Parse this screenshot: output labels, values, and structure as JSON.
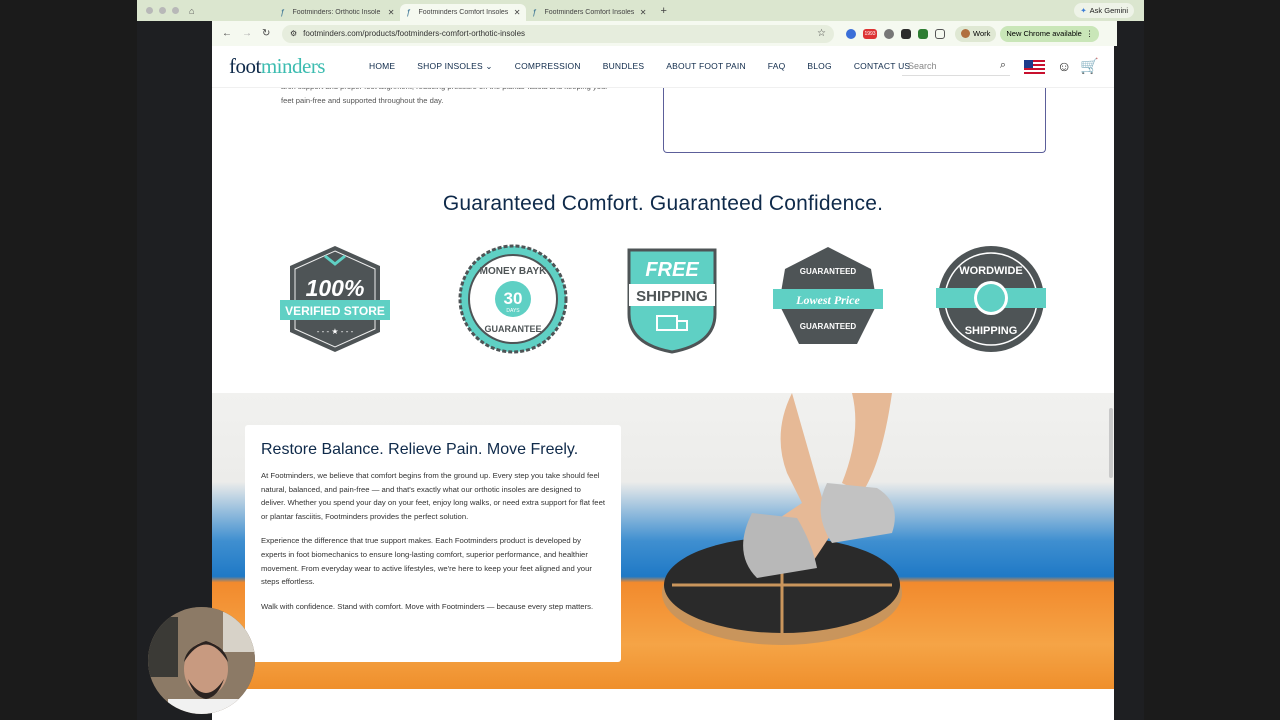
{
  "browser": {
    "tabs": [
      {
        "title": "Footminders: Orthotic Insole"
      },
      {
        "title": "Footminders Comfort Insoles"
      },
      {
        "title": "Footminders Comfort Insoles"
      }
    ],
    "ask_gemini": "Ask Gemini",
    "url": "footminders.com/products/footminders-comfort-orthotic-insoles",
    "profile": "Work",
    "new_chrome": "New Chrome available",
    "ext_badge": "1993"
  },
  "site": {
    "logo_left": "foot",
    "logo_right": "minders",
    "nav": [
      "HOME",
      "SHOP INSOLES",
      "COMPRESSION",
      "BUNDLES",
      "ABOUT FOOT PAIN",
      "FAQ",
      "BLOG",
      "CONTACT US"
    ],
    "search_placeholder": "Search"
  },
  "intro_text": "arch support and proper foot alignment, reducing pressure on the plantar fascia and keeping your feet pain-free and supported throughout the day.",
  "headline": "Guaranteed Comfort. Guaranteed Confidence.",
  "badges": [
    {
      "line1": "100%",
      "line2": "VERIFIED STORE"
    },
    {
      "line1": "MONEY BAYK",
      "line2": "30",
      "line3": "DAYS",
      "line4": "GUARANTEE"
    },
    {
      "line1": "FREE",
      "line2": "SHIPPING"
    },
    {
      "line1": "GUARANTEED",
      "line2": "Lowest Price",
      "line3": "GUARANTEED"
    },
    {
      "line1": "WORDWIDE",
      "line2": "SHIPPING"
    }
  ],
  "hero": {
    "title": "Restore Balance. Relieve Pain. Move Freely.",
    "p1": "At Footminders, we believe that comfort begins from the ground up. Every step you take should feel natural, balanced, and pain-free — and that's exactly what our orthotic insoles are designed to deliver. Whether you spend your day on your feet, enjoy long walks, or need extra support for flat feet or plantar fasciitis, Footminders provides the perfect solution.",
    "p2": "Experience the difference that true support makes. Each Footminders product is developed by experts in foot biomechanics to ensure long-lasting comfort, superior performance, and healthier movement. From everyday wear to active lifestyles, we're here to keep your feet aligned and your steps effortless.",
    "p3": "Walk with confidence. Stand with comfort. Move with Footminders — because every step matters."
  },
  "colors": {
    "navy": "#0f2a4a",
    "teal": "#5fd0c4",
    "badge_gray": "#4e5456"
  }
}
